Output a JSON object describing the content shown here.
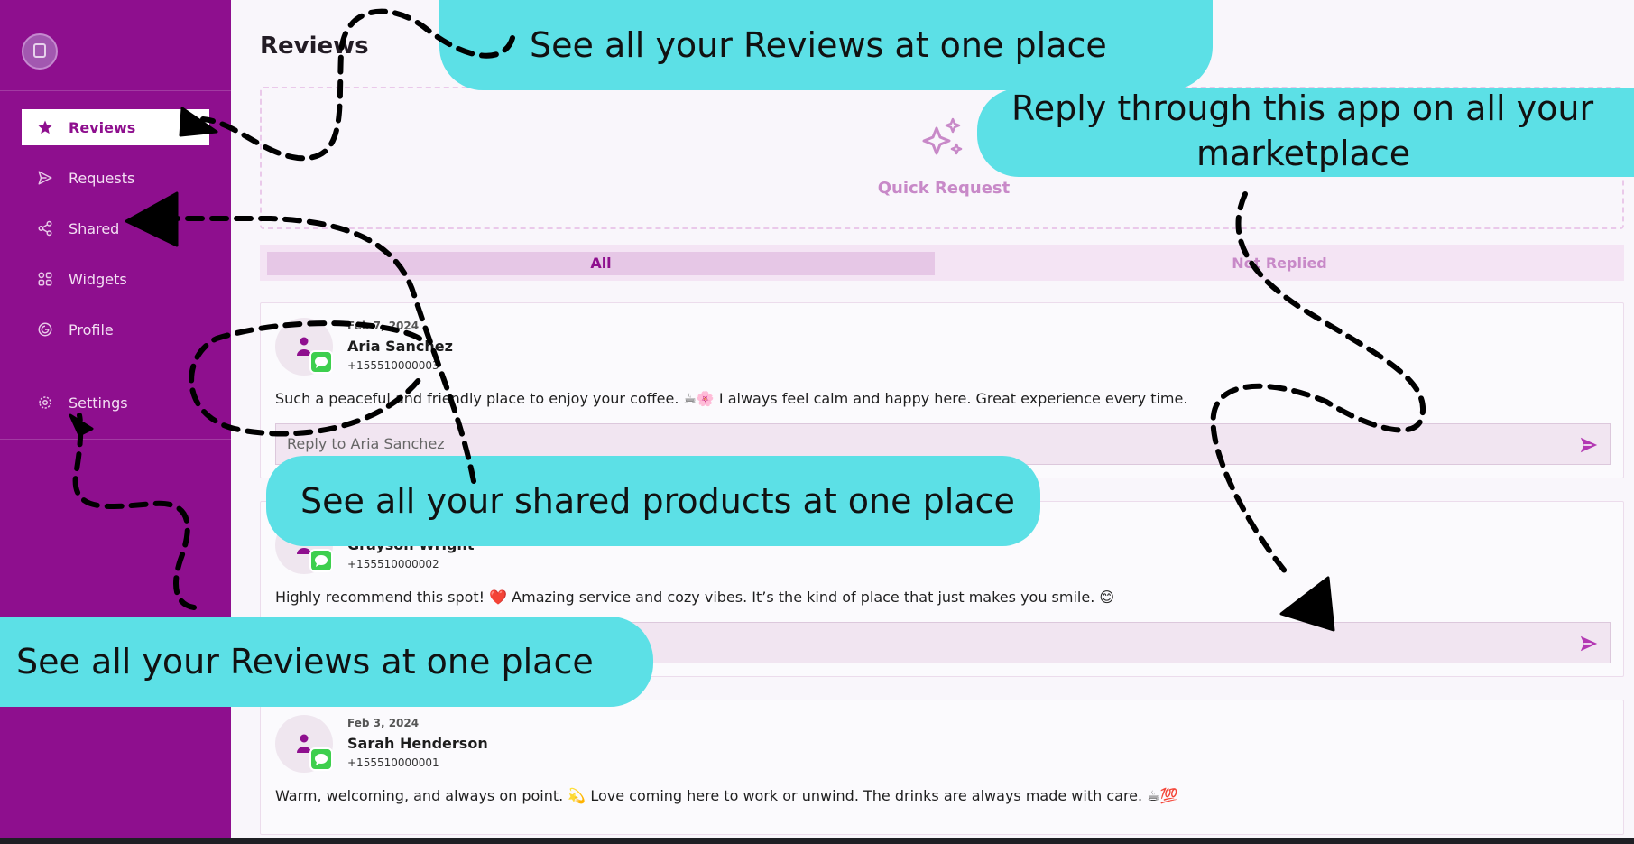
{
  "sidebar": {
    "items": [
      {
        "label": "Reviews",
        "icon": "star-icon"
      },
      {
        "label": "Requests",
        "icon": "send-outline-icon"
      },
      {
        "label": "Shared",
        "icon": "share-icon"
      },
      {
        "label": "Widgets",
        "icon": "grid-icon"
      },
      {
        "label": "Profile",
        "icon": "profile-icon"
      },
      {
        "label": "Settings",
        "icon": "gear-icon"
      }
    ]
  },
  "main": {
    "title": "Reviews",
    "quick_request": "Quick Request",
    "tabs": [
      "All",
      "Not Replied"
    ]
  },
  "reviews": [
    {
      "date": "Feb 7, 2024",
      "name": "Aria Sanchez",
      "phone": "+155510000003",
      "text": "Such a peaceful and friendly place to enjoy your coffee. ☕🌸 I always feel calm and happy here. Great experience every time.",
      "reply_placeholder": "Reply to Aria Sanchez"
    },
    {
      "date": "",
      "name": "Grayson Wright",
      "phone": "+155510000002",
      "text": "Highly recommend this spot! ❤️ Amazing service and cozy vibes. It’s the kind of place that just makes you smile. 😊",
      "reply_placeholder": ""
    },
    {
      "date": "Feb 3, 2024",
      "name": "Sarah Henderson",
      "phone": "+155510000001",
      "text": "Warm, welcoming, and always on point. 💫 Love coming here to work or unwind. The drinks are always made with care. ☕💯"
    }
  ],
  "callouts": {
    "top": "See all your Reviews at one place",
    "reply": [
      "Reply through this app on all your",
      "marketplace"
    ],
    "shared": "See all your shared products at one place",
    "bottom": "See all your Reviews at one place"
  },
  "colors": {
    "sidebar": "#8e0f8e",
    "callout": "#5ce0e6",
    "accent": "#8e0f8e"
  }
}
